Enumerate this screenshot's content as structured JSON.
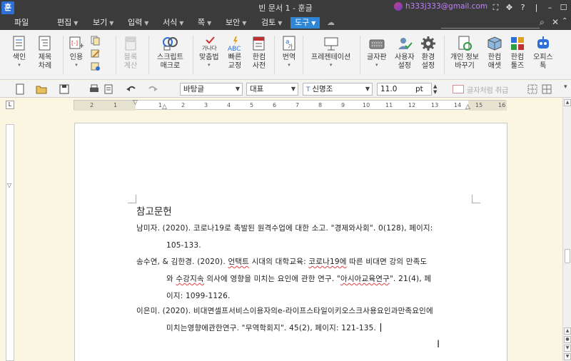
{
  "window": {
    "app_icon": "훈",
    "title": "빈 문서 1 - 훈글",
    "account_email": "h333j333@gmail.com",
    "controls": [
      "⛶",
      "✥",
      "?",
      "|",
      "–",
      "☐",
      "✕"
    ]
  },
  "menu": {
    "items": [
      "파일",
      "편집",
      "보기",
      "입력",
      "서식",
      "쪽",
      "보안",
      "검토",
      "도구"
    ],
    "active": "도구"
  },
  "ribbon": {
    "buttons": [
      {
        "l1": "색인",
        "l2": ""
      },
      {
        "l1": "제목",
        "l2": "차례"
      },
      {
        "l1": "인용",
        "l2": ""
      },
      {
        "l1": "블록",
        "l2": "계산"
      },
      {
        "l1": "스크립트",
        "l2": "매크로"
      },
      {
        "l1": "맞춤법",
        "l2": ""
      },
      {
        "l1": "빠른",
        "l2": "교정"
      },
      {
        "l1": "한컴",
        "l2": "사전"
      },
      {
        "l1": "번역",
        "l2": ""
      },
      {
        "l1": "프레젠테이션",
        "l2": ""
      },
      {
        "l1": "글자판",
        "l2": ""
      },
      {
        "l1": "사용자",
        "l2": "설정"
      },
      {
        "l1": "환경",
        "l2": "설정"
      },
      {
        "l1": "개인 정보",
        "l2": "바꾸기"
      },
      {
        "l1": "한컴",
        "l2": "애셋"
      },
      {
        "l1": "한컴",
        "l2": "툴즈"
      },
      {
        "l1": "오피스",
        "l2": "톡"
      }
    ],
    "spell_icon_text": "가나다",
    "abc_icon_text": "ABC"
  },
  "toolbar": {
    "style": "바탕글",
    "font_group": "대표",
    "font_name": "신명조",
    "font_size": "11.0",
    "size_unit": "pt",
    "char_shape_label": "글자처럼 취급"
  },
  "ruler": {
    "numbers": [
      "2",
      "1",
      "1",
      "2",
      "3",
      "4",
      "5",
      "6",
      "7",
      "8",
      "9",
      "10",
      "11",
      "12",
      "13",
      "14",
      "15",
      "16"
    ]
  },
  "document": {
    "heading": "참고문헌",
    "refs": [
      {
        "line1": "남미자. (2020). 코로나19로 촉발된 원격수업에 대한 소고. \"경제와사회\". 0(128), 페이지:",
        "line2": "105-133."
      },
      {
        "line1_a": "송수연, & 김한경. (2020). ",
        "line1_b": "언택트",
        "line1_c": " 시대의 대학교육: ",
        "line1_d": "코로나19에",
        "line1_e": " 따른 비대면 강의 만족도",
        "line2_a": "와 ",
        "line2_b": "수강지속",
        "line2_c": " 의사에 영향을 미치는 요인에 관한 연구. \"",
        "line2_d": "아시아교육연구",
        "line2_e": "\". 21(4), 페",
        "line3": "이지: 1099-1126."
      },
      {
        "line1": "이은미.  (2020).   비대면셀프서비스이용자의e-라이프스타일이키오스크사용요인과만족요인에",
        "line2": "미치는영향에관한연구. \"무역학회지\". 45(2), 페이지: 121-135."
      }
    ]
  }
}
